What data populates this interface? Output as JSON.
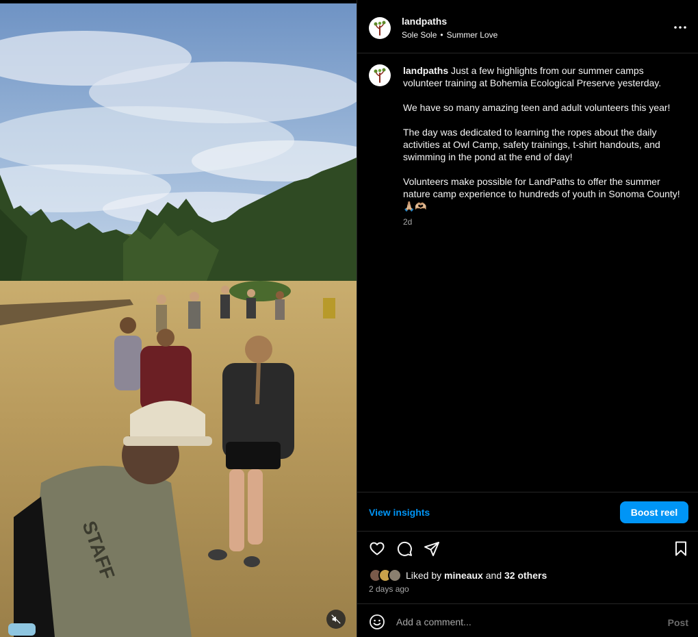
{
  "post": {
    "username": "landpaths",
    "audio": {
      "artist": "Sole Sole",
      "separator": "•",
      "track": "Summer Love"
    },
    "caption": {
      "username": "landpaths",
      "paragraphs": [
        "Just a few highlights from our summer camps volunteer training at Bohemia Ecological Preserve yesterday.",
        "We have so many amazing teen and adult volunteers this year!",
        "The day was dedicated to learning the ropes about the daily activities at Owl Camp, safety trainings, t-shirt handouts, and swimming in the pond at the end of day!",
        "Volunteers make possible for LandPaths to offer the summer nature camp experience to hundreds of youth in Sonoma County! 🙏🏼🫶🏼"
      ],
      "time": "2d"
    },
    "view_insights_label": "View insights",
    "boost_label": "Boost reel",
    "likes": {
      "prefix": "Liked by",
      "user": "mineaux",
      "conjunction": "and",
      "others": "32 others"
    },
    "date": "2 days ago",
    "comment": {
      "placeholder": "Add a comment...",
      "post_label": "Post"
    },
    "icons": {
      "more": "more-options-icon",
      "like": "heart-icon",
      "comment": "comment-icon",
      "share": "share-icon",
      "save": "bookmark-icon",
      "emoji": "emoji-icon",
      "mute": "muted-audio-icon"
    },
    "colors": {
      "accent": "#0095f6",
      "background": "#000000",
      "divider": "#262626",
      "muted_text": "#a8a8a8"
    }
  }
}
